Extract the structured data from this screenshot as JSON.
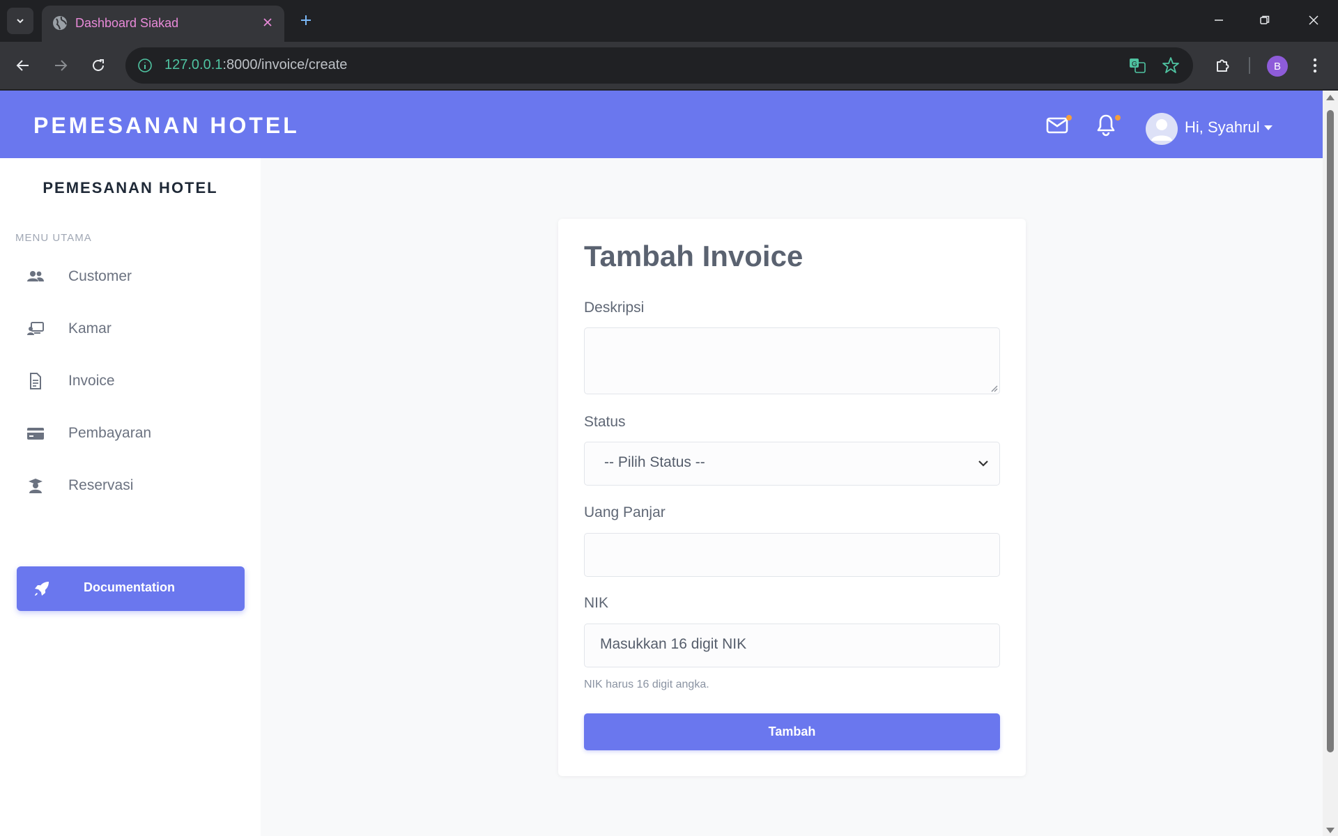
{
  "browser": {
    "tab_title": "Dashboard Siakad",
    "url_host": "127.0.0.1",
    "url_rest": ":8000/invoice/create",
    "profile_initial": "B"
  },
  "topnav": {
    "brand": "PEMESANAN HOTEL",
    "user_greeting": "Hi, Syahrul",
    "accent_color": "#6a77ee",
    "notification_dot_color": "#f59e3b"
  },
  "sidebar": {
    "brand": "PEMESANAN HOTEL",
    "section_heading": "MENU UTAMA",
    "items": [
      {
        "label": "Customer",
        "icon": "users-icon"
      },
      {
        "label": "Kamar",
        "icon": "room-icon"
      },
      {
        "label": "Invoice",
        "icon": "file-invoice-icon"
      },
      {
        "label": "Pembayaran",
        "icon": "credit-card-icon"
      },
      {
        "label": "Reservasi",
        "icon": "reservation-icon"
      }
    ],
    "documentation_button": "Documentation"
  },
  "form": {
    "title": "Tambah Invoice",
    "fields": {
      "deskripsi_label": "Deskripsi",
      "deskripsi_value": "",
      "status_label": "Status",
      "status_selected": "-- Pilih Status --",
      "uang_panjar_label": "Uang Panjar",
      "uang_panjar_value": "",
      "nik_label": "NIK",
      "nik_placeholder": "Masukkan 16 digit NIK",
      "nik_help": "NIK harus 16 digit angka."
    },
    "submit_label": "Tambah"
  }
}
